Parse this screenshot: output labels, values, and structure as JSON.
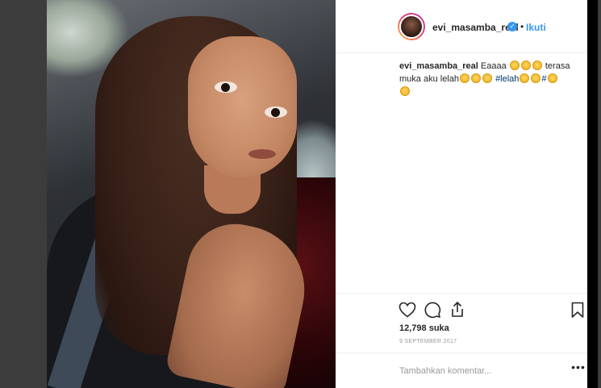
{
  "post": {
    "username": "evi_masamba_real",
    "follow_label": "Ikuti",
    "separator": "•",
    "verified_icon": "verified-badge-icon",
    "caption": {
      "username": "evi_masamba_real",
      "text_1": "Eaaaa",
      "text_2": "terasa muka aku lelah",
      "hashtag": "#lelah",
      "hash_2": "#"
    },
    "likes_label": "12,798 suka",
    "date": "9 SEPTEMBER 2017",
    "comment_placeholder": "Tambahkan komentar...",
    "more_label": "•••"
  },
  "colors": {
    "link_blue": "#3897f0",
    "hashtag": "#003569",
    "text": "#262626",
    "muted": "#999999"
  },
  "icons": {
    "like": "heart-icon",
    "comment": "comment-bubble-icon",
    "share": "share-icon",
    "save": "bookmark-icon"
  }
}
